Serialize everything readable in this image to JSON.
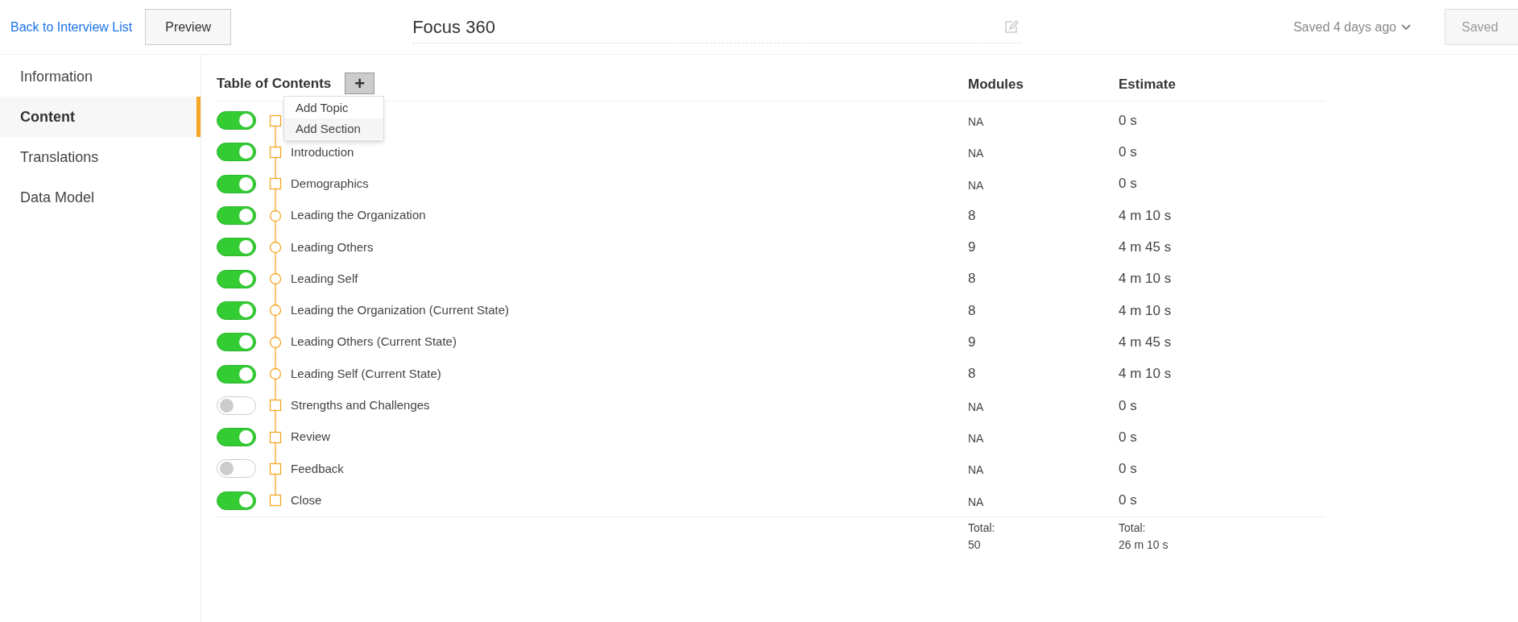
{
  "header": {
    "back_link": "Back to Interview List",
    "preview_button": "Preview",
    "title": "Focus 360",
    "saved_status": "Saved 4 days ago",
    "save_button": {
      "label": "Saved",
      "disabled": true
    }
  },
  "sidebar": {
    "items": [
      {
        "label": "Information",
        "selected": false
      },
      {
        "label": "Content",
        "selected": true
      },
      {
        "label": "Translations",
        "selected": false
      },
      {
        "label": "Data Model",
        "selected": false
      }
    ]
  },
  "table": {
    "title": "Table of Contents",
    "add_button": "+",
    "add_menu": {
      "expanded": true,
      "items": [
        {
          "label": "Add Topic",
          "selected": false
        },
        {
          "label": "Add Section",
          "selected": true
        }
      ]
    },
    "columns": [
      "Modules",
      "Estimate"
    ],
    "rows": [
      {
        "kind": "section",
        "on": true,
        "modules": "NA",
        "estimate": "0 s"
      },
      {
        "kind": "section",
        "on": true,
        "label": "Introduction",
        "modules": "NA",
        "estimate": "0 s"
      },
      {
        "kind": "section",
        "on": true,
        "label": "Demographics",
        "modules": "NA",
        "estimate": "0 s"
      },
      {
        "kind": "topic",
        "on": true,
        "label": "Leading the Organization",
        "modules": "8",
        "estimate": "4 m 10 s"
      },
      {
        "kind": "topic",
        "on": true,
        "label": "Leading Others",
        "modules": "9",
        "estimate": "4 m 45 s"
      },
      {
        "kind": "topic",
        "on": true,
        "label": "Leading Self",
        "modules": "8",
        "estimate": "4 m 10 s"
      },
      {
        "kind": "topic",
        "on": true,
        "label": "Leading the Organization (Current State)",
        "modules": "8",
        "estimate": "4 m 10 s"
      },
      {
        "kind": "topic",
        "on": true,
        "label": "Leading Others (Current State)",
        "modules": "9",
        "estimate": "4 m 45 s"
      },
      {
        "kind": "topic",
        "on": true,
        "label": "Leading Self (Current State)",
        "modules": "8",
        "estimate": "4 m 10 s"
      },
      {
        "kind": "section",
        "on": false,
        "label": "Strengths and Challenges",
        "modules": "NA",
        "estimate": "0 s"
      },
      {
        "kind": "section",
        "on": true,
        "label": "Review",
        "modules": "NA",
        "estimate": "0 s"
      },
      {
        "kind": "section",
        "on": false,
        "label": "Feedback",
        "modules": "NA",
        "estimate": "0 s"
      },
      {
        "kind": "section",
        "on": true,
        "label": "Close",
        "modules": "NA",
        "estimate": "0 s"
      }
    ],
    "totals": {
      "modules_label": "Total:",
      "modules": "50",
      "estimate_label": "Total:",
      "estimate": "26 m 10 s"
    }
  }
}
